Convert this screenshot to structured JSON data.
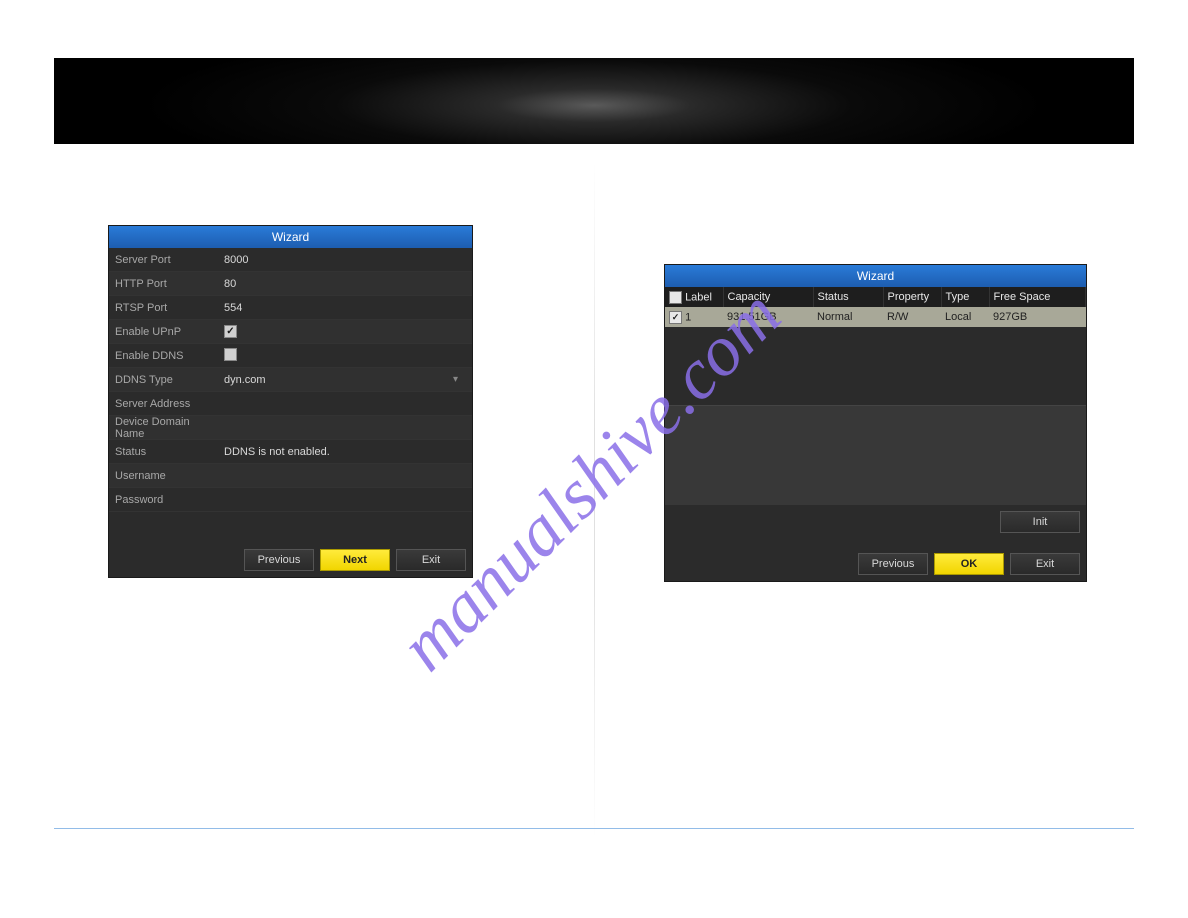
{
  "watermark_text": "manualshive.com",
  "left_panel": {
    "title": "Wizard",
    "rows": {
      "server_port": {
        "label": "Server Port",
        "value": "8000"
      },
      "http_port": {
        "label": "HTTP Port",
        "value": "80"
      },
      "rtsp_port": {
        "label": "RTSP Port",
        "value": "554"
      },
      "enable_upnp": {
        "label": "Enable UPnP",
        "checked": true
      },
      "enable_ddns": {
        "label": "Enable DDNS",
        "checked": false
      },
      "ddns_type": {
        "label": "DDNS Type",
        "value": "dyn.com"
      },
      "server_addr": {
        "label": "Server Address",
        "value": ""
      },
      "device_domain": {
        "label": "Device Domain Name",
        "value": ""
      },
      "status": {
        "label": "Status",
        "value": "DDNS is not enabled."
      },
      "username": {
        "label": "Username",
        "value": ""
      },
      "password": {
        "label": "Password",
        "value": ""
      }
    },
    "buttons": {
      "previous": "Previous",
      "next": "Next",
      "exit": "Exit"
    }
  },
  "right_panel": {
    "title": "Wizard",
    "columns": {
      "label": "Label",
      "capacity": "Capacity",
      "status": "Status",
      "property": "Property",
      "type": "Type",
      "free_space": "Free Space"
    },
    "rows": [
      {
        "checked": true,
        "label": "1",
        "capacity": "931.51GB",
        "status": "Normal",
        "property": "R/W",
        "type": "Local",
        "free_space": "927GB"
      }
    ],
    "init_button": "Init",
    "buttons": {
      "previous": "Previous",
      "ok": "OK",
      "exit": "Exit"
    }
  }
}
